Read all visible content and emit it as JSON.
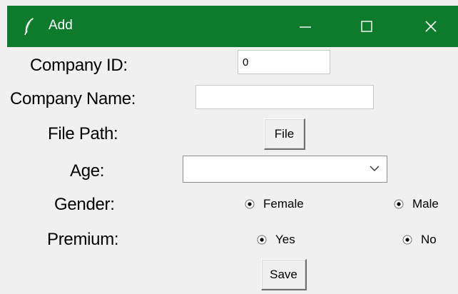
{
  "window": {
    "title": "Add",
    "minimize_glyph": "—",
    "icon": "feather-icon"
  },
  "form": {
    "company_id": {
      "label": "Company ID:",
      "value": "0"
    },
    "company_name": {
      "label": "Company Name:",
      "value": ""
    },
    "file_path": {
      "label": "File Path:",
      "button": "File"
    },
    "age": {
      "label": "Age:",
      "value": ""
    },
    "gender": {
      "label": "Gender:",
      "options": [
        {
          "label": "Female",
          "selected": true
        },
        {
          "label": "Male",
          "selected": true
        }
      ]
    },
    "premium": {
      "label": "Premium:",
      "options": [
        {
          "label": "Yes",
          "selected": true
        },
        {
          "label": "No",
          "selected": true
        }
      ]
    },
    "save_button": "Save"
  },
  "colors": {
    "titlebar": "#0e7a2c",
    "background": "#f0f0f0"
  }
}
